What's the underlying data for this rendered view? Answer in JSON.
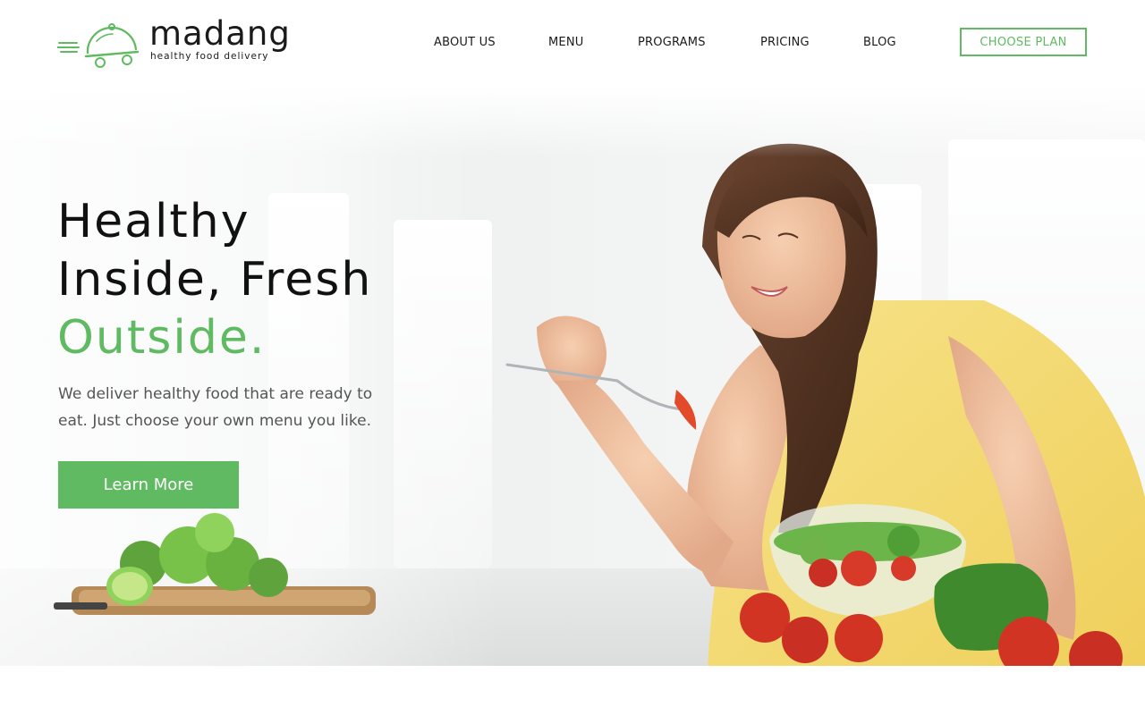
{
  "brand": {
    "name": "madang",
    "tagline": "healthy food delivery",
    "accent_color": "#5fba62"
  },
  "nav": {
    "items": [
      {
        "label": "ABOUT US"
      },
      {
        "label": "MENU"
      },
      {
        "label": "PROGRAMS"
      },
      {
        "label": "PRICING"
      },
      {
        "label": "BLOG"
      }
    ],
    "cta_label": "CHOOSE PLAN"
  },
  "hero": {
    "headline_line1": "Healthy",
    "headline_line2": "Inside, Fresh",
    "headline_line3": "Outside.",
    "description": "We deliver healthy food that are ready to eat. Just choose your own menu you like.",
    "button_label": "Learn More"
  }
}
